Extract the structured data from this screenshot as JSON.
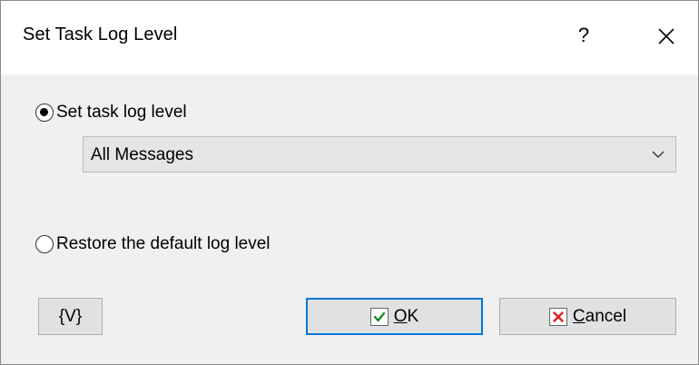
{
  "window": {
    "title": "Set Task Log Level",
    "help_label": "?",
    "close_label": "✕"
  },
  "options": {
    "set_level_label": "Set task log level",
    "set_level_selected": true,
    "log_level_value": "All Messages",
    "restore_label": "Restore the default log level",
    "restore_selected": false
  },
  "buttons": {
    "variables_label": "{V}",
    "ok_label": "OK",
    "cancel_label": "Cancel"
  },
  "colors": {
    "ok_check": "#1a8a1a",
    "cancel_x": "#e02020",
    "default_border": "#0078d7"
  }
}
